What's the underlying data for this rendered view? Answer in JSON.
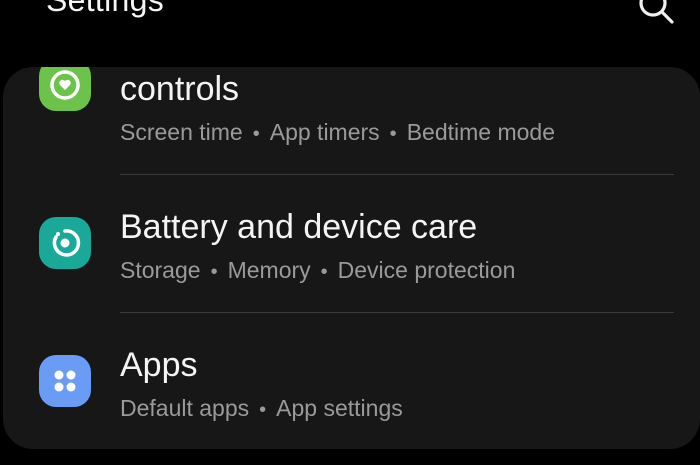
{
  "header": {
    "title": "Settings",
    "search_icon": "search-icon"
  },
  "items": [
    {
      "title": "controls",
      "icon": "heart-shield-icon",
      "icon_color": "#6cc24a",
      "subtitles": [
        "Screen time",
        "App timers",
        "Bedtime mode"
      ]
    },
    {
      "title": "Battery and device care",
      "icon": "device-care-icon",
      "icon_color": "#1aa999",
      "subtitles": [
        "Storage",
        "Memory",
        "Device protection"
      ]
    },
    {
      "title": "Apps",
      "icon": "apps-grid-icon",
      "icon_color": "#6b9cf5",
      "subtitles": [
        "Default apps",
        "App settings"
      ]
    }
  ],
  "separator": "•",
  "colors": {
    "background": "#000000",
    "card": "#171717",
    "title_text": "#f4f4f4",
    "subtitle_text": "#9a9a9a",
    "divider": "#3a3a3a"
  }
}
